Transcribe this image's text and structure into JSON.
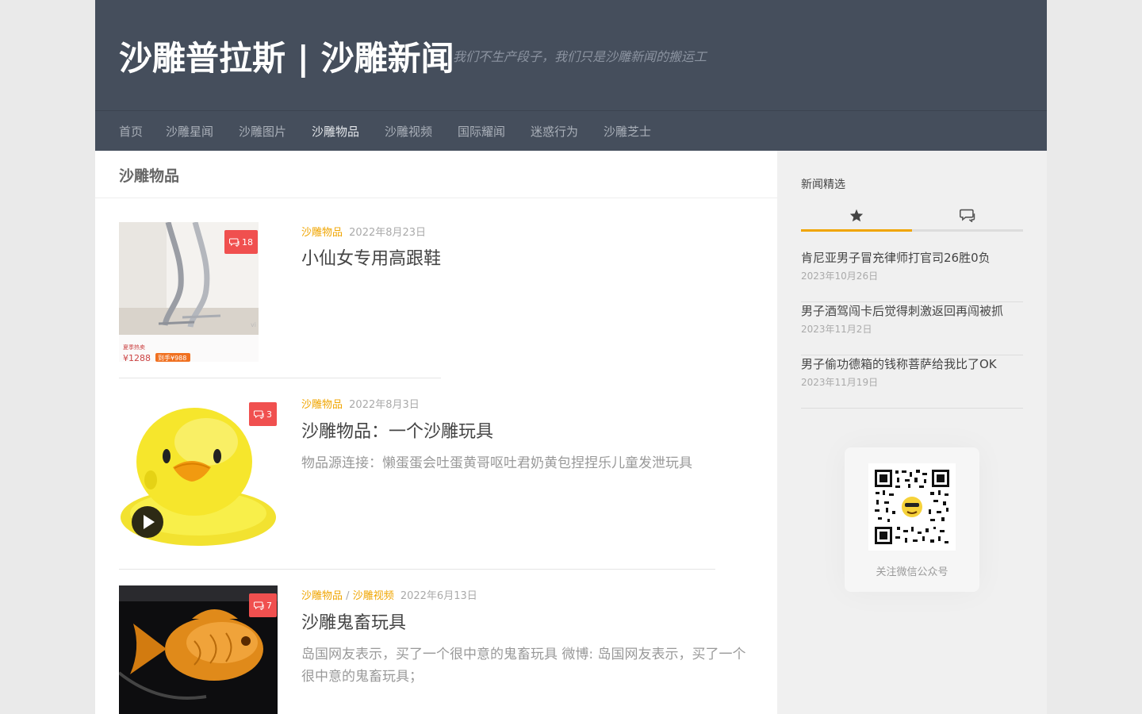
{
  "header": {
    "site_title": "沙雕普拉斯 | 沙雕新闻",
    "tagline": "我们不生产段子，我们只是沙雕新闻的搬运工"
  },
  "nav": {
    "items": [
      "首页",
      "沙雕星闻",
      "沙雕图片",
      "沙雕物品",
      "沙雕视频",
      "国际耀闻",
      "迷惑行为",
      "沙雕芝士"
    ],
    "active": "沙雕物品"
  },
  "page_title": "沙雕物品",
  "posts": [
    {
      "category": "沙雕物品",
      "date": "2022年8月23日",
      "title": "小仙女专用高跟鞋",
      "comments": "18",
      "thumb_price": "¥1288",
      "thumb_tag": "夏季热卖",
      "thumb_sale": "到手¥988",
      "thumb_watermark": "vi"
    },
    {
      "category": "沙雕物品",
      "date": "2022年8月3日",
      "title": "沙雕物品：一个沙雕玩具",
      "comments": "3",
      "excerpt": "物品源连接：懒蛋蛋会吐蛋黄哥呕吐君奶黄包捏捏乐儿童发泄玩具"
    },
    {
      "category": "沙雕物品",
      "category2": "沙雕视频",
      "separator": "/",
      "date": "2022年6月13日",
      "title": "沙雕鬼畜玩具",
      "comments": "7",
      "excerpt": "岛国网友表示，买了一个很中意的鬼畜玩具 微博: 岛国网友表示，买了一个很中意的鬼畜玩具；"
    }
  ],
  "sidebar": {
    "title": "新闻精选",
    "tabs": [
      "star-icon",
      "comments-icon"
    ],
    "news": [
      {
        "title": "肯尼亚男子冒充律师打官司26胜0负",
        "date": "2023年10月26日"
      },
      {
        "title": "男子酒驾闯卡后觉得刺激返回再闯被抓",
        "date": "2023年11月2日"
      },
      {
        "title": "男子偷功德箱的钱称菩萨给我比了OK",
        "date": "2023年11月19日"
      }
    ],
    "qr_label": "关注微信公众号"
  },
  "colors": {
    "header_bg": "#454e5c",
    "accent": "#f0a500",
    "badge": "#f0504f"
  }
}
